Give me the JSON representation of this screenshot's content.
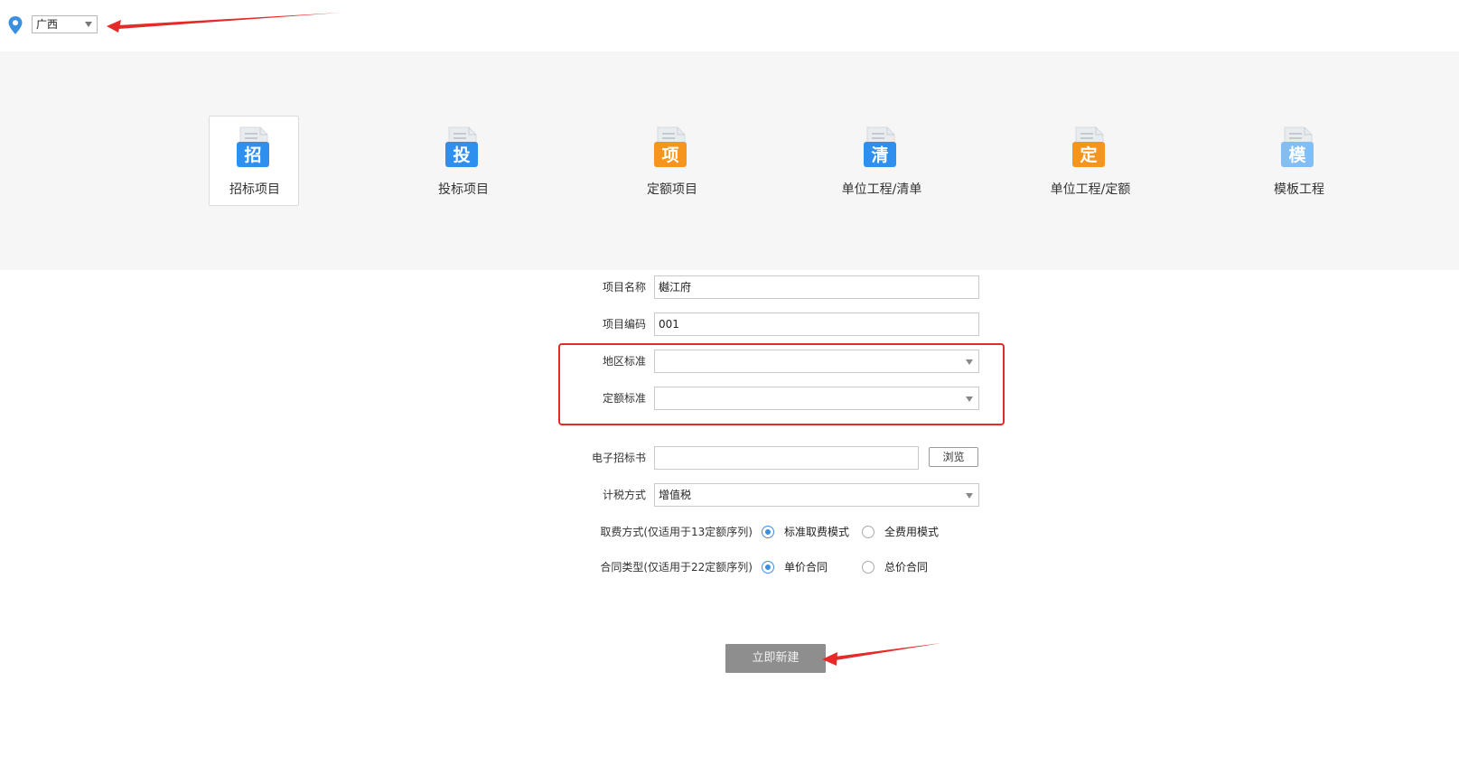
{
  "region": {
    "selected": "广西"
  },
  "project_types": [
    {
      "label": "招标项目",
      "glyph": "招",
      "color": "#2f8fef",
      "selected": true
    },
    {
      "label": "投标项目",
      "glyph": "投",
      "color": "#2f8fef",
      "selected": false
    },
    {
      "label": "定额项目",
      "glyph": "项",
      "color": "#f5951d",
      "selected": false
    },
    {
      "label": "单位工程/清单",
      "glyph": "清",
      "color": "#2f8fef",
      "selected": false
    },
    {
      "label": "单位工程/定额",
      "glyph": "定",
      "color": "#f5951d",
      "selected": false
    },
    {
      "label": "模板工程",
      "glyph": "模",
      "color": "#82bdf3",
      "selected": false
    }
  ],
  "form": {
    "project_name": {
      "label": "项目名称",
      "value": "樾江府"
    },
    "project_code": {
      "label": "项目编码",
      "value": "001"
    },
    "region_standard": {
      "label": "地区标准",
      "value": ""
    },
    "quota_standard": {
      "label": "定额标准",
      "value": ""
    },
    "e_tender": {
      "label": "电子招标书",
      "value": "",
      "browse_label": "浏览"
    },
    "tax_method": {
      "label": "计税方式",
      "value": "增值税"
    },
    "fee_mode": {
      "label": "取费方式(仅适用于13定额序列)",
      "options": [
        "标准取费模式",
        "全费用模式"
      ],
      "selected_index": 0
    },
    "contract_type": {
      "label": "合同类型(仅适用于22定额序列)",
      "options": [
        "单价合同",
        "总价合同"
      ],
      "selected_index": 0
    }
  },
  "create_button": {
    "label": "立即新建"
  },
  "colors": {
    "accent": "#3b8fe0",
    "annotation_red": "#e52a2a",
    "band_bg": "#f6f6f6",
    "button_gray": "#8e8e8e"
  },
  "icons": [
    "location-pin-icon",
    "caret-down-icon",
    "document-icon",
    "radio-icon",
    "arrow-annotation"
  ]
}
